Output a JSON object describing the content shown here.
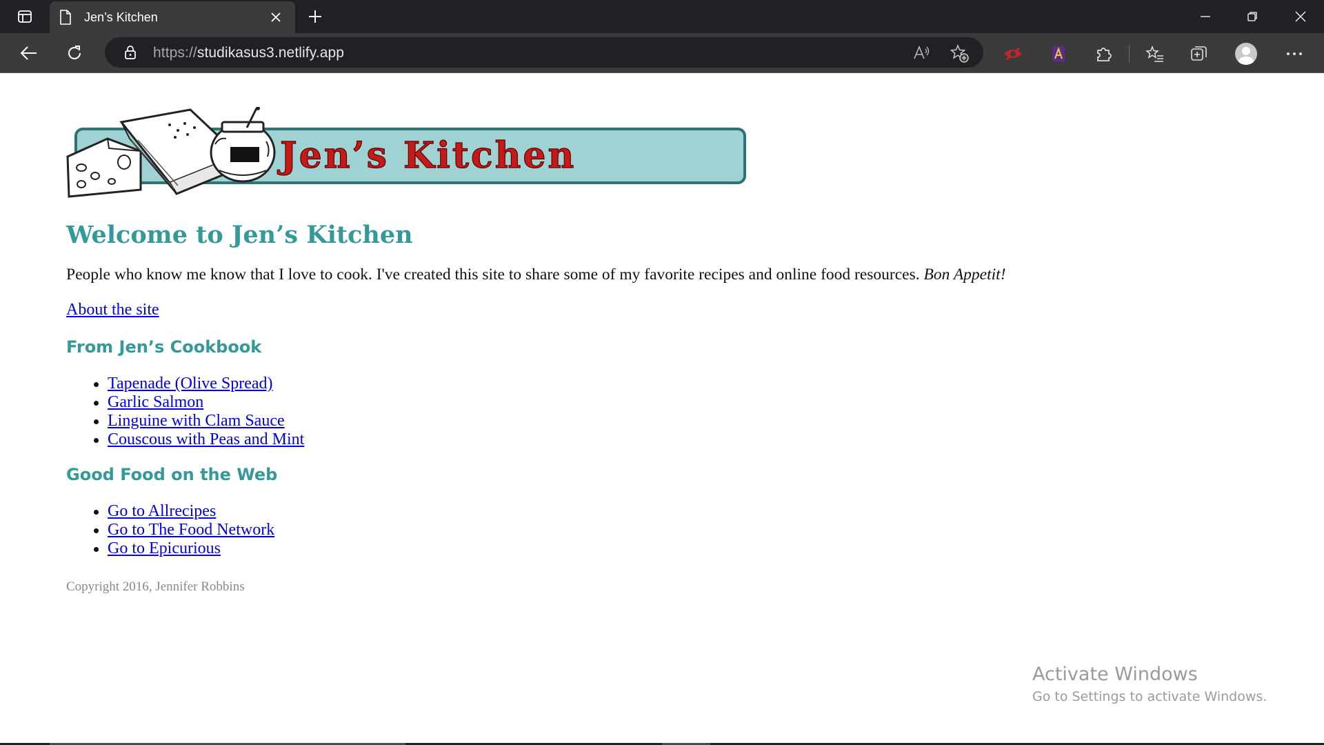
{
  "browser": {
    "tab": {
      "title": "Jen’s Kitchen"
    },
    "address": {
      "scheme": "https://",
      "host": "studikasus3.netlify.app"
    },
    "icons": {
      "tab_actions": "tab-actions-icon",
      "page": "page-icon",
      "close": "close-icon",
      "new_tab": "plus-icon",
      "back": "back-arrow-icon",
      "refresh": "refresh-icon",
      "lock": "lock-icon",
      "read_aloud": "read-aloud-icon",
      "favorite": "add-favorite-icon",
      "extensions": [
        "red-extension-icon",
        "purple-extension-icon",
        "puzzle-icon"
      ],
      "favorites": "favorites-list-icon",
      "collections": "collections-icon",
      "profile": "profile-avatar-icon",
      "more": "more-menu-icon"
    }
  },
  "page": {
    "banner": {
      "text": "Jen’s Kitchen"
    },
    "heading": "Welcome to Jen’s Kitchen",
    "intro": {
      "text": "People who know me know that I love to cook. I've created this site to share some of my favorite recipes and online food resources.",
      "emphasis": "Bon Appetit!"
    },
    "about_link": "About the site",
    "cookbook": {
      "heading": "From Jen’s Cookbook",
      "items": [
        "Tapenade (Olive Spread)",
        "Garlic Salmon",
        "Linguine with Clam Sauce",
        "Couscous with Peas and Mint"
      ]
    },
    "web": {
      "heading": "Good Food on the Web",
      "items": [
        "Go to Allrecipes",
        "Go to The Food Network",
        "Go to Epicurious"
      ]
    },
    "copyright": "Copyright 2016, Jennifer Robbins"
  },
  "overlay": {
    "title": "Activate Windows",
    "subtitle": "Go to Settings to activate Windows."
  },
  "colors": {
    "heading": "#339999",
    "link": "#0000ee",
    "banner_red": "#c41a1a",
    "banner_teal": "#9fd3d3"
  }
}
